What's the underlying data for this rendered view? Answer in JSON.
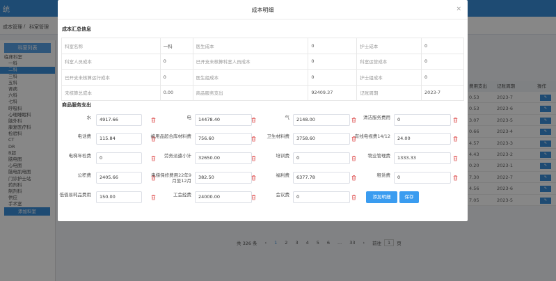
{
  "app": {
    "title_fragment": "统"
  },
  "breadcrumb": {
    "item1": "成本管理",
    "sep": "/",
    "item2": "科室管理"
  },
  "sidebar": {
    "header": "科室列表",
    "items": [
      "临床科室",
      "一科",
      "二科",
      "三科",
      "五科",
      "肾病",
      "六科",
      "七科",
      "呼吸科",
      "心理睡眠科",
      "脑外科",
      "康复医疗科",
      "检验科",
      "CT",
      "DR",
      "B超",
      "脑电图",
      "心电图",
      "脑电肌电图",
      "门诊护士站",
      "药剂科",
      "制剂科",
      "供应",
      "手术室",
      "麻醉科"
    ],
    "add_button": "添加科室"
  },
  "right_table": {
    "headers": [
      "费用支出",
      "记账周期",
      "操作"
    ],
    "rows": [
      {
        "amount": "0.53",
        "period": "2023-7"
      },
      {
        "amount": "0.53",
        "period": "2023-6"
      },
      {
        "amount": "3.07",
        "period": "2023-5"
      },
      {
        "amount": "0.66",
        "period": "2023-4"
      },
      {
        "amount": "4.57",
        "period": "2023-3"
      },
      {
        "amount": "4.43",
        "period": "2023-2"
      },
      {
        "amount": "0.20",
        "period": "2023-1"
      },
      {
        "amount": "7.30",
        "period": "2022-7"
      },
      {
        "amount": "4.56",
        "period": "2023-6"
      },
      {
        "amount": "7.05",
        "period": "2023-5"
      }
    ],
    "op_label": "✎"
  },
  "pager": {
    "total": "共 326 条",
    "prev": "‹",
    "pages": [
      "1",
      "2",
      "3",
      "4",
      "5",
      "6",
      "...",
      "33"
    ],
    "next": "›",
    "goto": "前往",
    "goto_val": "1",
    "page_unit": "页"
  },
  "modal": {
    "title": "成本明细",
    "close": "×",
    "summary_title": "成本汇总信息",
    "summary": [
      [
        "科室名称",
        "一科",
        "医生成本",
        "0",
        "护士成本",
        "0"
      ],
      [
        "科室人员成本",
        "0",
        "已开支未核算科室人员成本",
        "0",
        "科室运营成本",
        "0"
      ],
      [
        "已开支未核算运行成本",
        "0",
        "医生组成本",
        "0",
        "护士组成本",
        "0"
      ],
      [
        "未核算总成本",
        "0.00",
        "商品服务支出",
        "92409.37",
        "记账周期",
        "2023-7"
      ]
    ],
    "detail_title": "商品服务支出",
    "fields": [
      {
        "label": "水",
        "value": "4917.66"
      },
      {
        "label": "电",
        "value": "14478.40"
      },
      {
        "label": "气",
        "value": "2148.00"
      },
      {
        "label": "清洁服务费用",
        "value": "0"
      },
      {
        "label": "电话费",
        "value": "115.84"
      },
      {
        "label": "被用品超合库材料费",
        "value": "756.60"
      },
      {
        "label": "卫生材料费",
        "value": "3758.60"
      },
      {
        "label": "有线电视费14/12",
        "value": "24.00"
      },
      {
        "label": "电梯年检费",
        "value": "0"
      },
      {
        "label": "劳务派遣小计",
        "value": "32650.00"
      },
      {
        "label": "培训费",
        "value": "0"
      },
      {
        "label": "物业管理费",
        "value": "1333.33"
      },
      {
        "label": "公积费",
        "value": "2405.66"
      },
      {
        "label": "电梯保修费用22年9月至12月",
        "value": "382.50"
      },
      {
        "label": "福利费",
        "value": "6377.78"
      },
      {
        "label": "租赁费",
        "value": "0"
      },
      {
        "label": "低值易耗品费用",
        "value": "150.00"
      },
      {
        "label": "工会经费",
        "value": "24000.00"
      },
      {
        "label": "会议费",
        "value": "0"
      }
    ],
    "add_detail_button": "添加明细",
    "save_button": "保存"
  }
}
